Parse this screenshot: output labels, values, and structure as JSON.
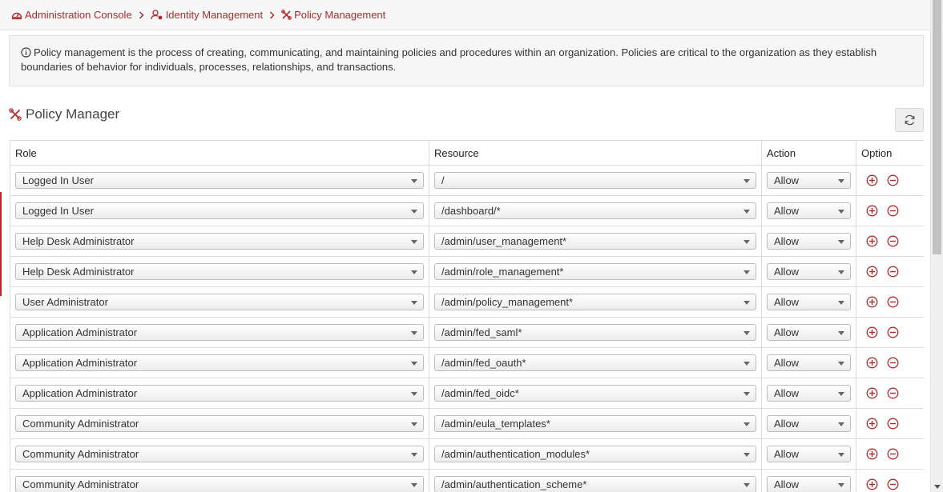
{
  "breadcrumb": [
    {
      "label": "Administration Console",
      "icon": "dashboard-icon"
    },
    {
      "label": "Identity Management",
      "icon": "user-gear-icon"
    },
    {
      "label": "Policy Management",
      "icon": "tools-icon"
    }
  ],
  "info": {
    "text": "Policy management is the process of creating, communicating, and maintaining policies and procedures within an organization. Policies are critical to the organization as they establish boundaries of behavior for individuals, processes, relationships, and transactions."
  },
  "section": {
    "title": "Policy Manager"
  },
  "table": {
    "headers": {
      "role": "Role",
      "resource": "Resource",
      "action": "Action",
      "option": "Option"
    },
    "rows": [
      {
        "role": "Logged In User",
        "resource": "/",
        "action": "Allow"
      },
      {
        "role": "Logged In User",
        "resource": "/dashboard/*",
        "action": "Allow"
      },
      {
        "role": "Help Desk Administrator",
        "resource": "/admin/user_management*",
        "action": "Allow"
      },
      {
        "role": "Help Desk Administrator",
        "resource": "/admin/role_management*",
        "action": "Allow"
      },
      {
        "role": "User Administrator",
        "resource": "/admin/policy_management*",
        "action": "Allow"
      },
      {
        "role": "Application Administrator",
        "resource": "/admin/fed_saml*",
        "action": "Allow"
      },
      {
        "role": "Application Administrator",
        "resource": "/admin/fed_oauth*",
        "action": "Allow"
      },
      {
        "role": "Application Administrator",
        "resource": "/admin/fed_oidc*",
        "action": "Allow"
      },
      {
        "role": "Community Administrator",
        "resource": "/admin/eula_templates*",
        "action": "Allow"
      },
      {
        "role": "Community Administrator",
        "resource": "/admin/authentication_modules*",
        "action": "Allow"
      },
      {
        "role": "Community Administrator",
        "resource": "/admin/authentication_scheme*",
        "action": "Allow"
      }
    ]
  },
  "colors": {
    "accent": "#b22a2a"
  }
}
